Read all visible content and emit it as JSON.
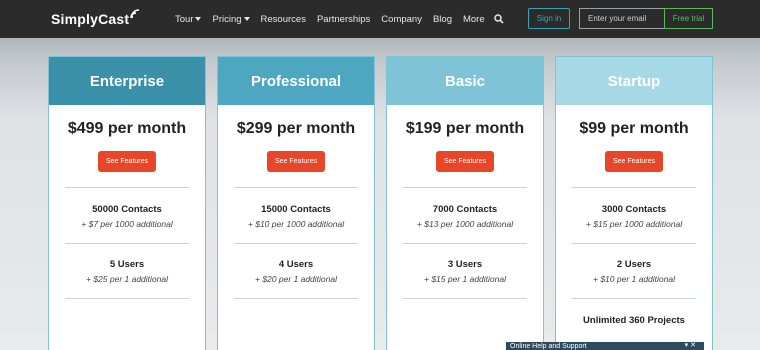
{
  "header": {
    "brand": "SimplyCast",
    "nav": [
      {
        "label": "Tour",
        "dropdown": true
      },
      {
        "label": "Pricing",
        "dropdown": true
      },
      {
        "label": "Resources",
        "dropdown": false
      },
      {
        "label": "Partnerships",
        "dropdown": false
      },
      {
        "label": "Company",
        "dropdown": false
      },
      {
        "label": "Blog",
        "dropdown": false
      },
      {
        "label": "More",
        "dropdown": false
      }
    ],
    "search_icon": "search-icon",
    "signin_label": "Sign in",
    "email_placeholder": "Enter your email",
    "trial_label": "Free trial"
  },
  "plans": [
    {
      "name": "Enterprise",
      "color": "#3a8fa9",
      "price": "$499 per month",
      "button": "See Features",
      "contacts": "50000 Contacts",
      "contacts_extra": "+ $7 per 1000 additional",
      "users": "5 Users",
      "users_extra": "+ $25 per 1 additional"
    },
    {
      "name": "Professional",
      "color": "#4ea7c1",
      "price": "$299 per month",
      "button": "See Features",
      "contacts": "15000 Contacts",
      "contacts_extra": "+ $10 per 1000 additional",
      "users": "4 Users",
      "users_extra": "+ $20 per 1 additional"
    },
    {
      "name": "Basic",
      "color": "#7ec3d6",
      "price": "$199 per month",
      "button": "See Features",
      "contacts": "7000 Contacts",
      "contacts_extra": "+ $13 per 1000 additional",
      "users": "3 Users",
      "users_extra": "+ $15 per 1 additional"
    },
    {
      "name": "Startup",
      "color": "#a7d8e6",
      "price": "$99 per month",
      "button": "See Features",
      "contacts": "3000 Contacts",
      "contacts_extra": "+ $15 per 1000 additional",
      "users": "2 Users",
      "users_extra": "+ $10 per 1 additional",
      "projects": "Unlimited 360 Projects"
    }
  ],
  "chat": {
    "label": "Online Help and Support",
    "controls": "▾ ✕"
  }
}
